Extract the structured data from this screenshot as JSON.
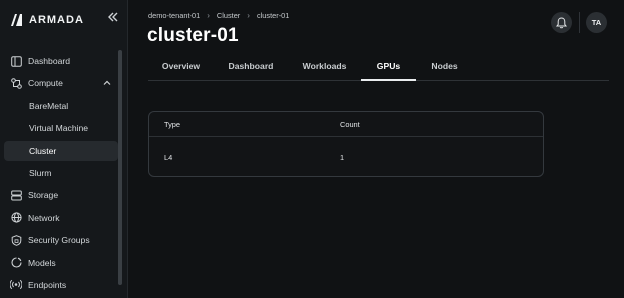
{
  "brand": {
    "name": "ARMADA"
  },
  "sidebar": {
    "items": [
      {
        "label": "Dashboard",
        "icon": "dashboard-icon"
      },
      {
        "label": "Compute",
        "icon": "compute-icon"
      },
      {
        "label": "BareMetal"
      },
      {
        "label": "Virtual Machine"
      },
      {
        "label": "Cluster"
      },
      {
        "label": "Slurm"
      },
      {
        "label": "Storage",
        "icon": "storage-icon"
      },
      {
        "label": "Network",
        "icon": "network-icon"
      },
      {
        "label": "Security Groups",
        "icon": "shield-icon"
      },
      {
        "label": "Models",
        "icon": "models-icon"
      },
      {
        "label": "Endpoints",
        "icon": "endpoints-icon"
      }
    ],
    "active": "Cluster"
  },
  "breadcrumb": [
    "demo-tenant-01",
    "Cluster",
    "cluster-01"
  ],
  "page": {
    "title": "cluster-01"
  },
  "header": {
    "avatar_initials": "TA"
  },
  "tabs": [
    {
      "label": "Overview"
    },
    {
      "label": "Dashboard"
    },
    {
      "label": "Workloads"
    },
    {
      "label": "GPUs"
    },
    {
      "label": "Nodes"
    }
  ],
  "active_tab": "GPUs",
  "gpu_table": {
    "columns": [
      "Type",
      "Count"
    ],
    "rows": [
      {
        "type": "L4",
        "count": "1"
      }
    ]
  }
}
